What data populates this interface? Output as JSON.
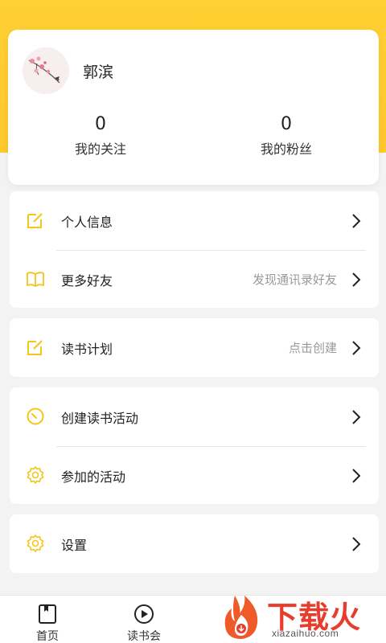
{
  "profile": {
    "username": "郭滨",
    "following_count": "0",
    "following_label": "我的关注",
    "fans_count": "0",
    "fans_label": "我的粉丝"
  },
  "menu_group_1": [
    {
      "label": "个人信息",
      "hint": "",
      "icon": "edit-icon"
    },
    {
      "label": "更多好友",
      "hint": "发现通讯录好友",
      "icon": "book-icon"
    }
  ],
  "menu_group_2": [
    {
      "label": "读书计划",
      "hint": "点击创建",
      "icon": "edit-icon"
    }
  ],
  "menu_group_3": [
    {
      "label": "创建读书活动",
      "hint": "",
      "icon": "timer-icon"
    },
    {
      "label": "参加的活动",
      "hint": "",
      "icon": "gear-icon"
    }
  ],
  "menu_group_4": [
    {
      "label": "设置",
      "hint": "",
      "icon": "gear-icon"
    }
  ],
  "tabbar": {
    "home_label": "首页",
    "club_label": "读书会"
  },
  "watermark": {
    "text": "下载火",
    "url": "xiazaihuo.com"
  },
  "colors": {
    "accent": "#ffc82c",
    "icon": "#f5c518",
    "hint": "#999999",
    "watermark": "#e83d2c"
  }
}
